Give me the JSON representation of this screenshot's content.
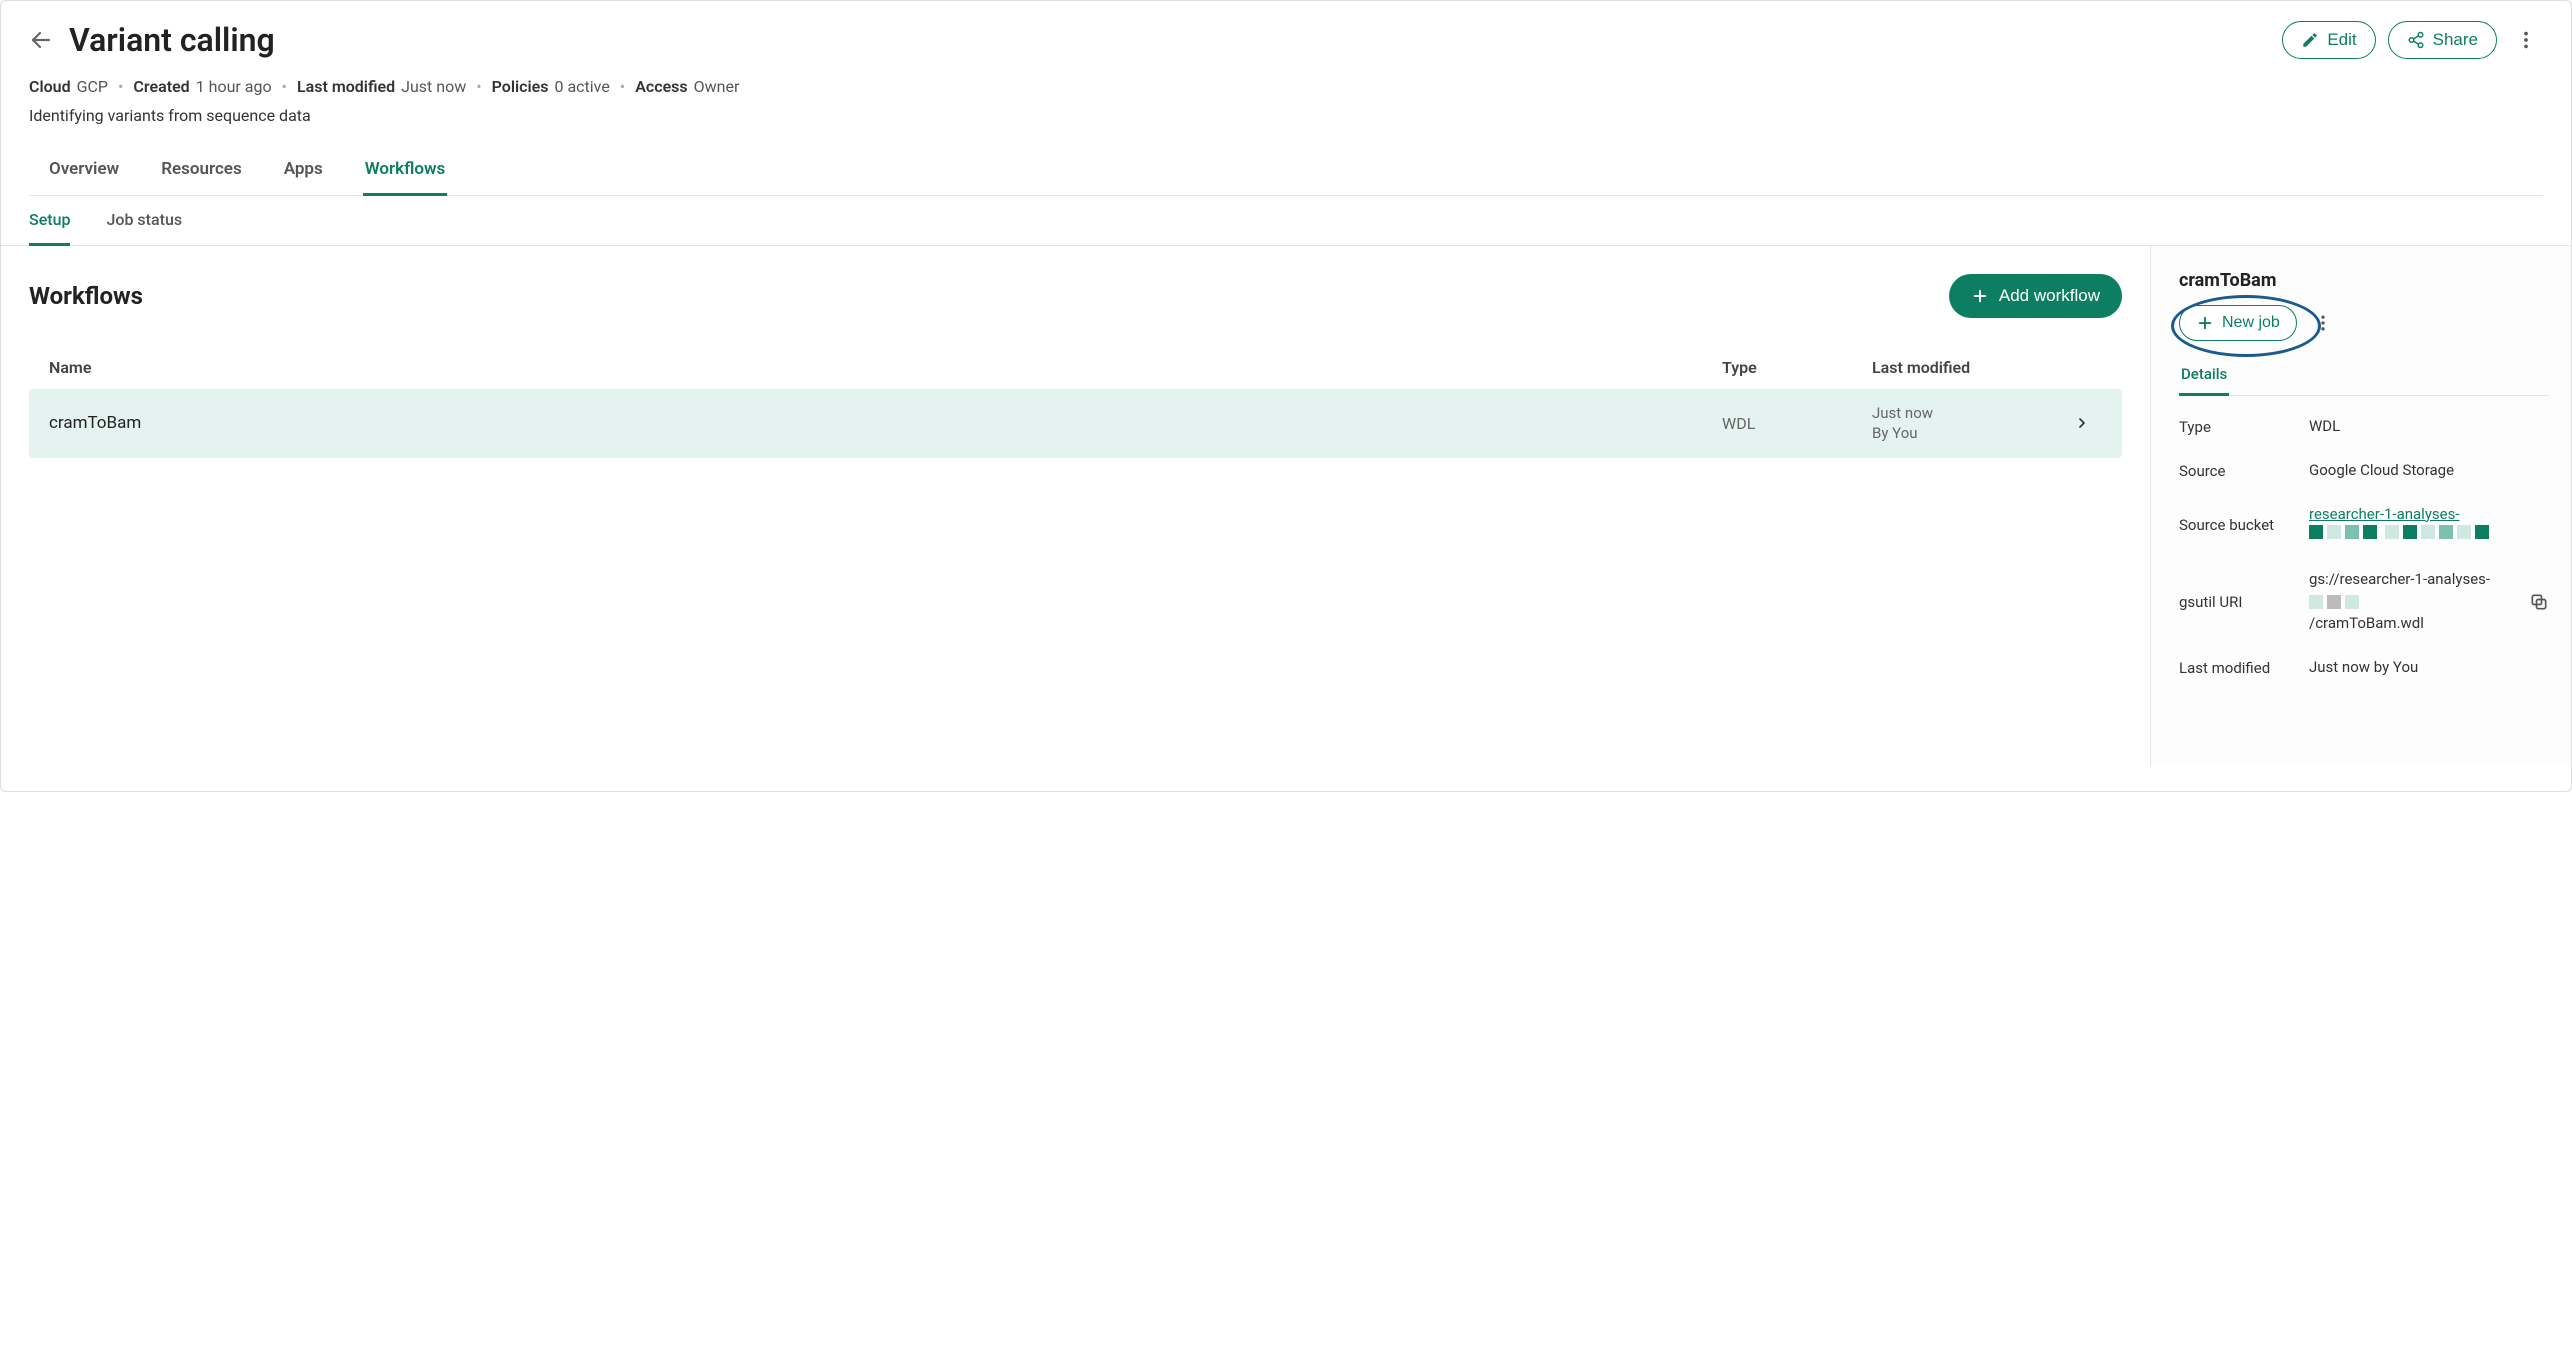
{
  "header": {
    "title": "Variant calling",
    "edit_label": "Edit",
    "share_label": "Share"
  },
  "meta": {
    "cloud_label": "Cloud",
    "cloud_value": "GCP",
    "created_label": "Created",
    "created_value": "1 hour ago",
    "modified_label": "Last modified",
    "modified_value": "Just now",
    "policies_label": "Policies",
    "policies_value": "0 active",
    "access_label": "Access",
    "access_value": "Owner"
  },
  "description": "Identifying variants from sequence data",
  "tabs": {
    "overview": "Overview",
    "resources": "Resources",
    "apps": "Apps",
    "workflows": "Workflows"
  },
  "subtabs": {
    "setup": "Setup",
    "job_status": "Job status"
  },
  "workflows": {
    "section_title": "Workflows",
    "add_label": "Add workflow",
    "columns": {
      "name": "Name",
      "type": "Type",
      "last_modified": "Last modified"
    },
    "rows": [
      {
        "name": "cramToBam",
        "type": "WDL",
        "last_modified_line1": "Just now",
        "last_modified_line2": "By You"
      }
    ]
  },
  "side": {
    "title": "cramToBam",
    "new_job_label": "New job",
    "details_tab": "Details",
    "fields": {
      "type_label": "Type",
      "type_value": "WDL",
      "source_label": "Source",
      "source_value": "Google Cloud Storage",
      "bucket_label": "Source bucket",
      "bucket_value": "researcher-1-analyses-",
      "gsutil_label": "gsutil URI",
      "gsutil_value_line1": "gs://researcher-1-analyses-",
      "gsutil_value_line2": "/cramToBam.wdl",
      "modified_label": "Last modified",
      "modified_value": "Just now by You"
    }
  }
}
